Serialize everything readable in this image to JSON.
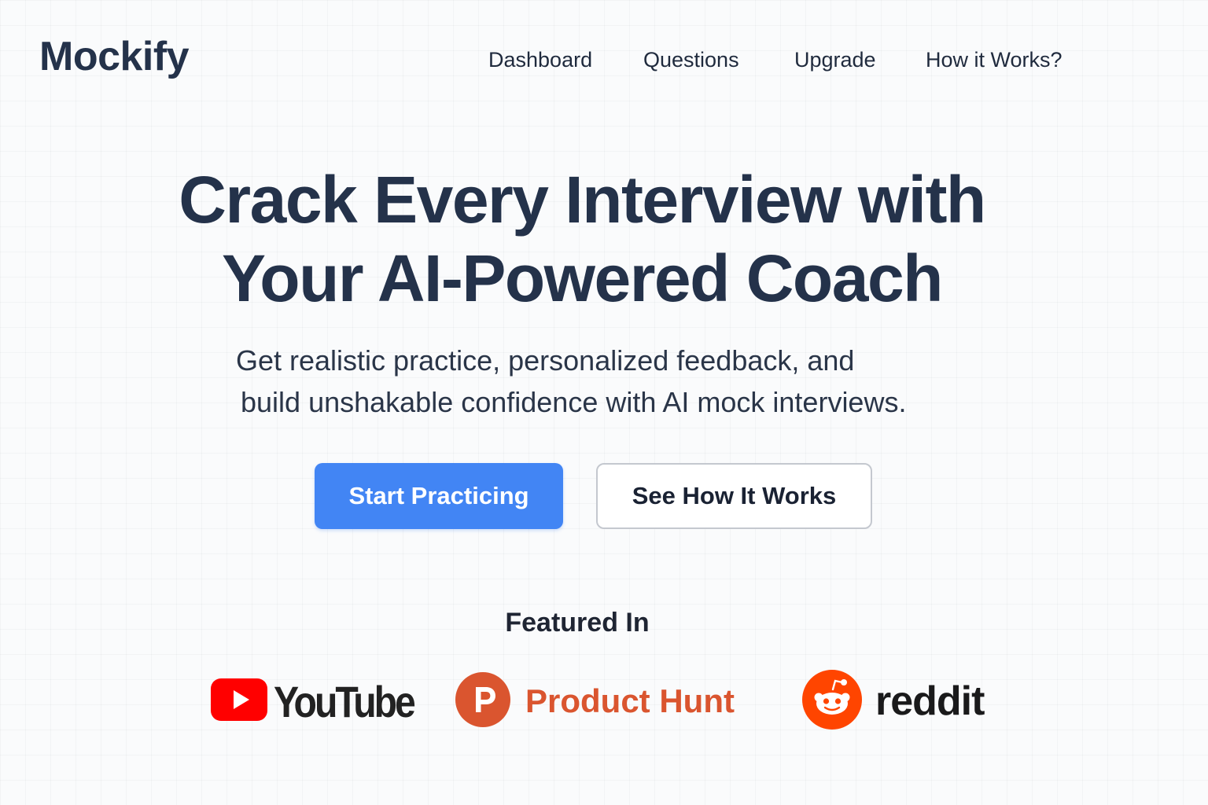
{
  "header": {
    "logo": "Mockify",
    "nav": {
      "dashboard": "Dashboard",
      "questions": "Questions",
      "upgrade": "Upgrade",
      "how_it_works": "How it Works?"
    }
  },
  "hero": {
    "title_line1": "Crack Every Interview with",
    "title_line2": "Your AI-Powered Coach",
    "subtitle_line1": "Get realistic practice, personalized feedback, and",
    "subtitle_line2": "build unshakable confidence with AI mock interviews.",
    "primary_button": "Start Practicing",
    "secondary_button": "See How It Works"
  },
  "featured": {
    "heading": "Featured In",
    "brands": {
      "youtube": {
        "name": "YouTube",
        "icon": "youtube-play-icon",
        "color": "#ff0000"
      },
      "product_hunt": {
        "name": "Product Hunt",
        "icon": "product-hunt-icon",
        "color": "#da552f"
      },
      "reddit": {
        "name": "reddit",
        "icon": "reddit-alien-icon",
        "color": "#ff4500"
      }
    }
  },
  "colors": {
    "primary": "#4285f4",
    "heading": "#24324a",
    "background": "#fafbfc"
  }
}
